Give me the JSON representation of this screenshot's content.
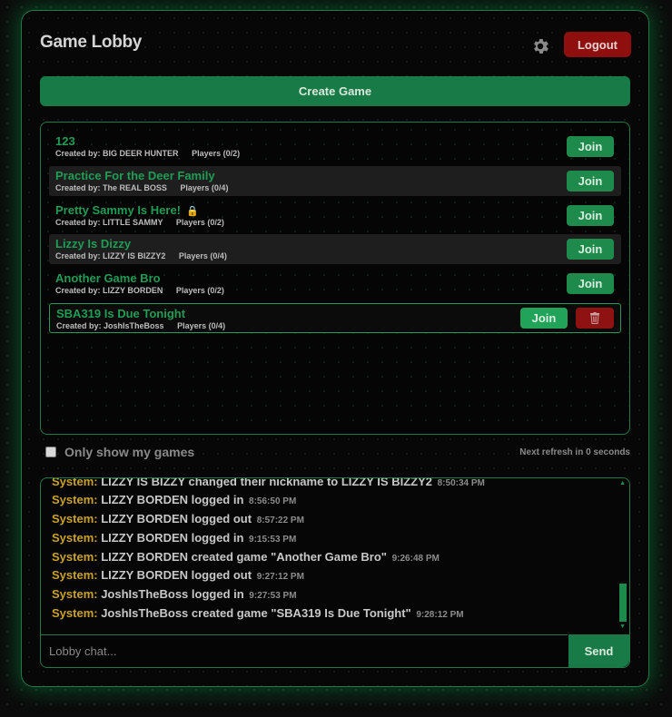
{
  "header": {
    "title": "Game Lobby",
    "logout_label": "Logout",
    "create_label": "Create Game"
  },
  "games": [
    {
      "name": "123",
      "created_by_label": "Created by:",
      "creator": "BIG DEER HUNTER",
      "players": "Players (0/2)",
      "join_label": "Join"
    },
    {
      "name": "Practice For the Deer Family",
      "created_by_label": "Created by:",
      "creator": "The REAL BOSS",
      "players": "Players (0/4)",
      "join_label": "Join"
    },
    {
      "name": "Pretty Sammy Is Here!",
      "created_by_label": "Created by:",
      "creator": "LITTLE SAMMY",
      "players": "Players (0/2)",
      "join_label": "Join",
      "locked": true
    },
    {
      "name": "Lizzy Is Dizzy",
      "created_by_label": "Created by:",
      "creator": "LIZZY IS BIZZY2",
      "players": "Players (0/4)",
      "join_label": "Join"
    },
    {
      "name": "Another Game Bro",
      "created_by_label": "Created by:",
      "creator": "LIZZY BORDEN",
      "players": "Players (0/2)",
      "join_label": "Join"
    },
    {
      "name": "SBA319 Is Due Tonight",
      "created_by_label": "Created by:",
      "creator": "JoshIsTheBoss",
      "players": "Players (0/4)",
      "join_label": "Join",
      "own": true
    }
  ],
  "filter": {
    "label": "Only show my games",
    "checked": false
  },
  "refresh_text": "Next refresh in 0 seconds",
  "chat": {
    "messages": [
      {
        "sender": "System:",
        "text": "LIZZY IS BIZZY changed their nickname to LIZZY IS BIZZY2",
        "time": "8:50:34 PM"
      },
      {
        "sender": "System:",
        "text": "LIZZY BORDEN logged in",
        "time": "8:56:50 PM"
      },
      {
        "sender": "System:",
        "text": "LIZZY BORDEN logged out",
        "time": "8:57:22 PM"
      },
      {
        "sender": "System:",
        "text": "LIZZY BORDEN logged in",
        "time": "9:15:53 PM"
      },
      {
        "sender": "System:",
        "text": "LIZZY BORDEN created game \"Another Game Bro\"",
        "time": "9:26:48 PM"
      },
      {
        "sender": "System:",
        "text": "LIZZY BORDEN logged out",
        "time": "9:27:12 PM"
      },
      {
        "sender": "System:",
        "text": "JoshIsTheBoss logged in",
        "time": "9:27:53 PM"
      },
      {
        "sender": "System:",
        "text": "JoshIsTheBoss created game \"SBA319 Is Due Tonight\"",
        "time": "9:28:12 PM"
      }
    ],
    "input_placeholder": "Lobby chat...",
    "send_label": "Send"
  },
  "colors": {
    "accent_green": "#1f9d55",
    "button_green": "#187a47",
    "danger_red": "#8f0f0f",
    "system_gold": "#c9a227"
  },
  "icons": {
    "settings": "gear-icon",
    "lock": "lock-icon",
    "delete": "trash-icon"
  }
}
